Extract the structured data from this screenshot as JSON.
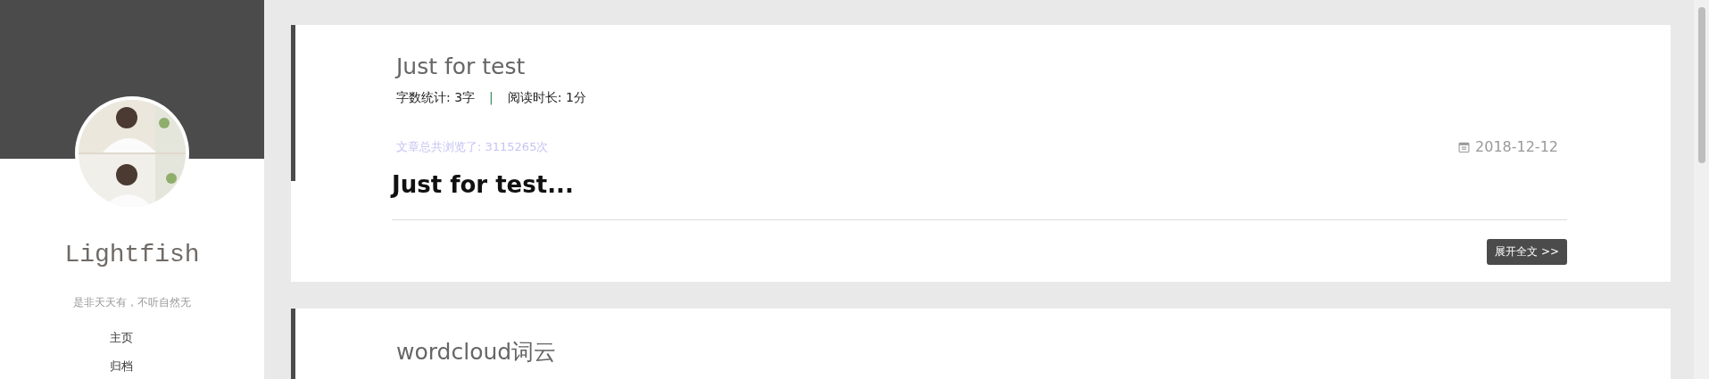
{
  "sidebar": {
    "name": "Lightfish",
    "motto": "是非天天有，不听自然无",
    "nav": [
      {
        "label": "主页"
      },
      {
        "label": "归档"
      }
    ]
  },
  "posts": [
    {
      "title": "Just for test",
      "word_count": "字数统计: 3字",
      "separator": "|",
      "read_time": "阅读时长: 1分",
      "views": "文章总共浏览了: 3115265次",
      "date": "2018-12-12",
      "excerpt": "Just for test...",
      "read_more": "展开全文 >>"
    },
    {
      "title": "wordcloud词云"
    }
  ]
}
